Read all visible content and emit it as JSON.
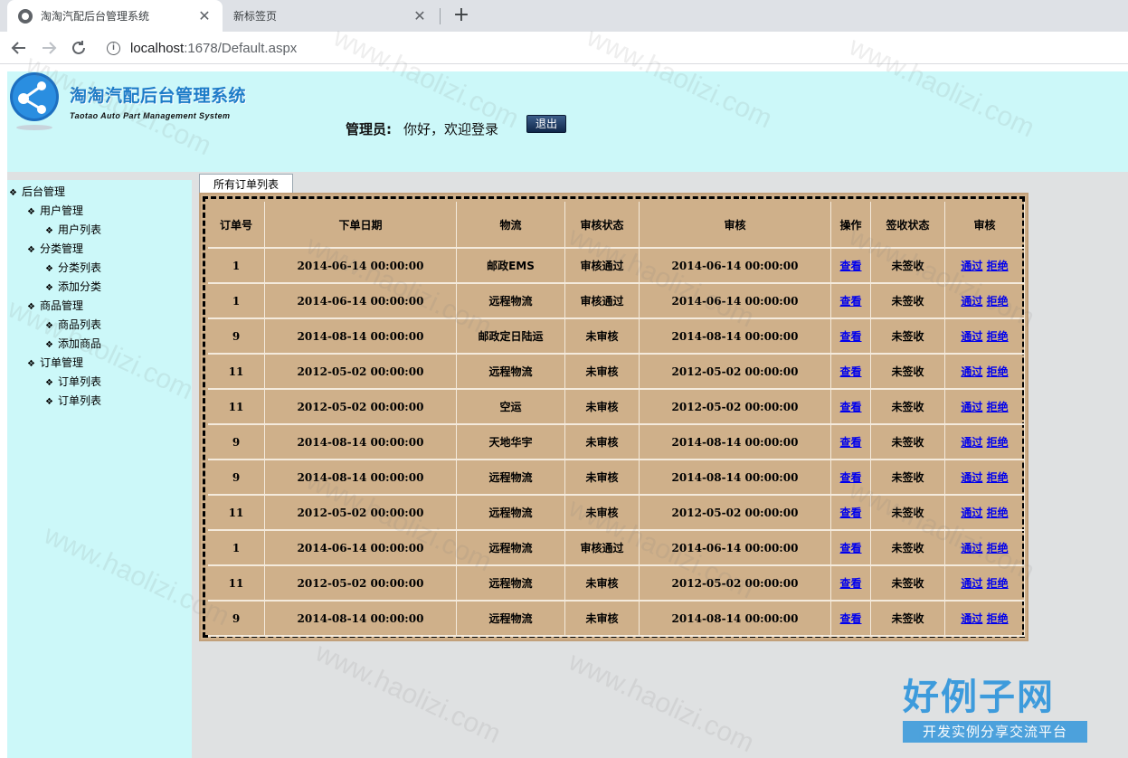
{
  "browser": {
    "tabs": [
      {
        "title": "淘淘汽配后台管理系统",
        "active": true
      },
      {
        "title": "新标签页",
        "active": false
      }
    ],
    "close_glyph": "✕",
    "new_tab_glyph": "+",
    "url_host": "localhost",
    "url_path": ":1678/Default.aspx",
    "icons": {
      "back": "arrow-left-icon",
      "forward": "arrow-right-icon",
      "reload": "reload-icon",
      "info": "info-icon"
    }
  },
  "header": {
    "title": "淘淘汽配后台管理系统",
    "subtitle": "Taotao Auto Part Management System",
    "admin_label": "管理员:",
    "admin_text": "你好，欢迎登录",
    "logout_label": "退出"
  },
  "sidebar": {
    "root": "后台管理",
    "groups": [
      {
        "label": "用户管理",
        "items": [
          "用户列表"
        ]
      },
      {
        "label": "分类管理",
        "items": [
          "分类列表",
          "添加分类"
        ]
      },
      {
        "label": "商品管理",
        "items": [
          "商品列表",
          "添加商品"
        ]
      },
      {
        "label": "订单管理",
        "items": [
          "订单列表",
          "订单列表"
        ]
      }
    ]
  },
  "content": {
    "tab_label": "所有订单列表",
    "columns": [
      "订单号",
      "下单日期",
      "物流",
      "审核状态",
      "审核",
      "操作",
      "签收状态",
      "审核"
    ],
    "view_label": "查看",
    "approve_label": "通过",
    "reject_label": "拒绝",
    "rows": [
      {
        "id": "1",
        "date": "2014-06-14 00:00:00",
        "logistics": "邮政EMS",
        "status": "审核通过",
        "audit_date": "2014-06-14 00:00:00",
        "sign": "未签收"
      },
      {
        "id": "1",
        "date": "2014-06-14 00:00:00",
        "logistics": "远程物流",
        "status": "审核通过",
        "audit_date": "2014-06-14 00:00:00",
        "sign": "未签收"
      },
      {
        "id": "9",
        "date": "2014-08-14 00:00:00",
        "logistics": "邮政定日陆运",
        "status": "未审核",
        "audit_date": "2014-08-14 00:00:00",
        "sign": "未签收"
      },
      {
        "id": "11",
        "date": "2012-05-02 00:00:00",
        "logistics": "远程物流",
        "status": "未审核",
        "audit_date": "2012-05-02 00:00:00",
        "sign": "未签收"
      },
      {
        "id": "11",
        "date": "2012-05-02 00:00:00",
        "logistics": "空运",
        "status": "未审核",
        "audit_date": "2012-05-02 00:00:00",
        "sign": "未签收"
      },
      {
        "id": "9",
        "date": "2014-08-14 00:00:00",
        "logistics": "天地华宇",
        "status": "未审核",
        "audit_date": "2014-08-14 00:00:00",
        "sign": "未签收"
      },
      {
        "id": "9",
        "date": "2014-08-14 00:00:00",
        "logistics": "远程物流",
        "status": "未审核",
        "audit_date": "2014-08-14 00:00:00",
        "sign": "未签收"
      },
      {
        "id": "11",
        "date": "2012-05-02 00:00:00",
        "logistics": "远程物流",
        "status": "未审核",
        "audit_date": "2012-05-02 00:00:00",
        "sign": "未签收"
      },
      {
        "id": "1",
        "date": "2014-06-14 00:00:00",
        "logistics": "远程物流",
        "status": "审核通过",
        "audit_date": "2014-06-14 00:00:00",
        "sign": "未签收"
      },
      {
        "id": "11",
        "date": "2012-05-02 00:00:00",
        "logistics": "远程物流",
        "status": "未审核",
        "audit_date": "2012-05-02 00:00:00",
        "sign": "未签收"
      },
      {
        "id": "9",
        "date": "2014-08-14 00:00:00",
        "logistics": "远程物流",
        "status": "未审核",
        "audit_date": "2014-08-14 00:00:00",
        "sign": "未签收"
      }
    ]
  },
  "watermark": {
    "text": "www.haolizi.com",
    "brand": "好例子网",
    "brand_sub": "开发实例分享交流平台"
  }
}
